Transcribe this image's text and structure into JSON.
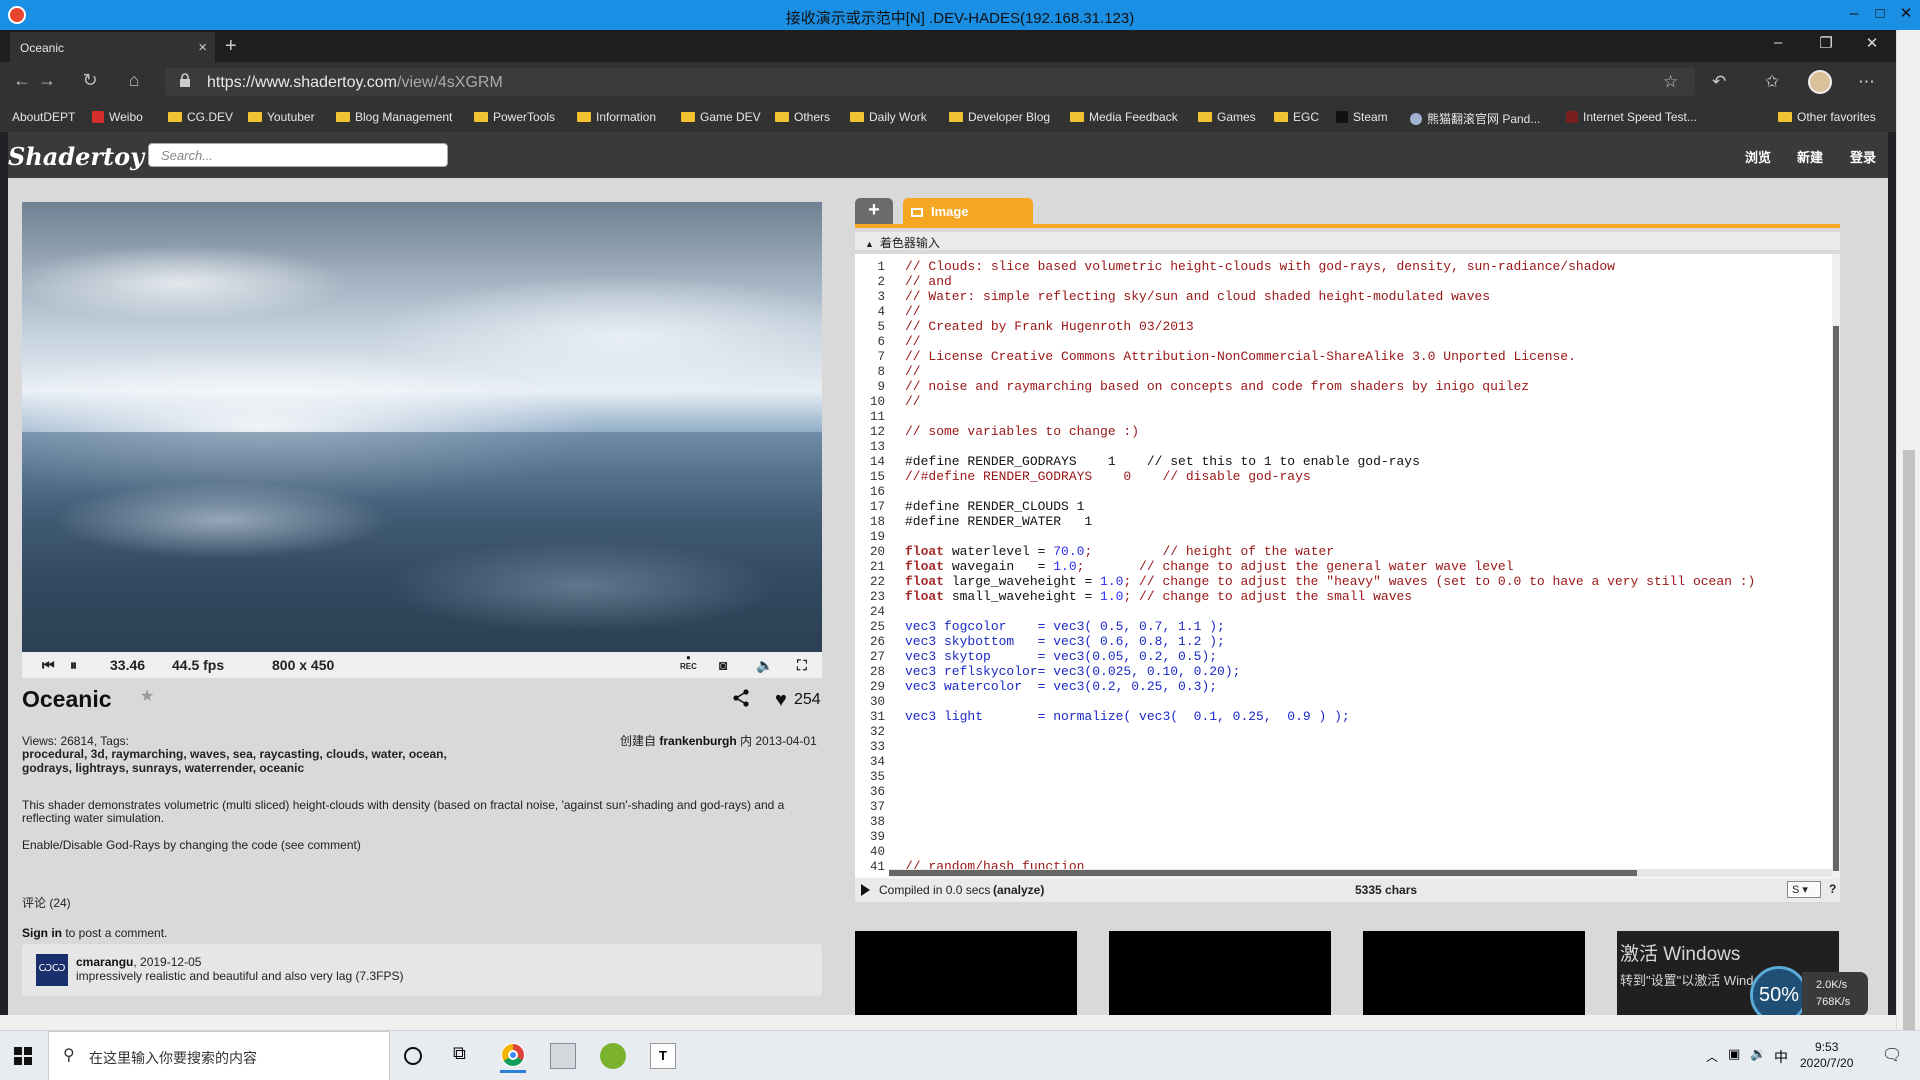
{
  "remote_desktop": {
    "title": "接收演示或示范中[N] .DEV-HADES(192.168.31.123)"
  },
  "browser": {
    "tab_title": "Oceanic",
    "url_main": "https://www.shadertoy.com",
    "url_path": "/view/4sXGRM",
    "bookmarks": [
      "AboutDEPT",
      "Weibo",
      "CG.DEV",
      "Youtuber",
      "Blog Management",
      "PowerTools",
      "Information",
      "Game DEV",
      "Others",
      "Daily Work",
      "Developer Blog",
      "Media Feedback",
      "Games",
      "EGC",
      "Steam",
      "熊猫翻滚官网 Pand...",
      "Internet Speed Test..."
    ],
    "other_favorites": "Other favorites"
  },
  "shadertoy": {
    "logo": "Shadertoy",
    "search_placeholder": "Search...",
    "nav": [
      "浏览",
      "新建",
      "登录"
    ],
    "player": {
      "time": "33.46",
      "fps": "44.5 fps",
      "resolution": "800 x 450",
      "rec_label": "REC"
    },
    "shader": {
      "title": "Oceanic",
      "likes": "254",
      "views_line": "Views: 26814, Tags:",
      "tags_line1": "procedural, 3d, raymarching, waves, sea, raycasting, clouds, water, ocean,",
      "tags_line2": "godrays, lightrays, sunrays, waterrender, oceanic",
      "created_prefix": "创建自",
      "author": "frankenburgh",
      "created_suffix": "内 2013-04-01",
      "description_1": "This shader demonstrates volumetric (multi sliced) height-clouds with density (based on fractal noise, 'against sun'-shading and god-rays) and a",
      "description_2": "reflecting water simulation.",
      "description_3": "Enable/Disable God-Rays by changing the code (see comment)",
      "comments_count": "评论 (24)",
      "signin_link": "Sign in",
      "signin_suffix": "to post a comment.",
      "comment": {
        "user": "cmarangu",
        "date": ", 2019-12-05",
        "text": "impressively realistic and beautiful and also very lag (7.3FPS)"
      }
    },
    "editor": {
      "add_tab": "+",
      "tab_label": "Image",
      "inputs_label": "着色器输入",
      "compiled": "Compiled in 0.0 secs",
      "analyze": "(analyze)",
      "chars": "5335 chars",
      "select_value": "S",
      "help": "?",
      "line_numbers": [
        "1",
        "2",
        "3",
        "4",
        "5",
        "6",
        "7",
        "8",
        "9",
        "10",
        "11",
        "12",
        "13",
        "14",
        "15",
        "16",
        "17",
        "18",
        "19",
        "20",
        "21",
        "22",
        "23",
        "24",
        "25",
        "26",
        "27",
        "28",
        "29",
        "30",
        "31",
        "32",
        "33",
        "34",
        "35",
        "36",
        "37",
        "38",
        "39",
        "40",
        "41"
      ],
      "code": {
        "l1": "// Clouds: slice based volumetric height-clouds with god-rays, density, sun-radiance/shadow",
        "l2": "// and",
        "l3": "// Water: simple reflecting sky/sun and cloud shaded height-modulated waves",
        "l4": "//",
        "l5": "// Created by Frank Hugenroth 03/2013",
        "l6": "//",
        "l7": "// License Creative Commons Attribution-NonCommercial-ShareAlike 3.0 Unported License.",
        "l8": "//",
        "l9": "// noise and raymarching based on concepts and code from shaders by inigo quilez",
        "l10": "//",
        "l12": "// some variables to change :)",
        "l14": "#define RENDER_GODRAYS    1    // set this to 1 to enable god-rays",
        "l15": "//#define RENDER_GODRAYS    0    // disable god-rays",
        "l17": "#define RENDER_CLOUDS 1",
        "l18": "#define RENDER_WATER   1",
        "l20_kw": "float",
        "l20_rest": " waterlevel = ",
        "l20_num": "70.0",
        "l20_cm": ";         // height of the water",
        "l21_kw": "float",
        "l21_rest": " wavegain   = ",
        "l21_num": "1.0",
        "l21_cm": ";       // change to adjust the general water wave level",
        "l22_kw": "float",
        "l22_rest": " large_waveheight = ",
        "l22_num": "1.0",
        "l22_cm": "; // change to adjust the \"heavy\" waves (set to 0.0 to have a very still ocean :)",
        "l23_kw": "float",
        "l23_rest": " small_waveheight = ",
        "l23_num": "1.0",
        "l23_cm": "; // change to adjust the small waves",
        "l25": "vec3 fogcolor    = vec3( 0.5, 0.7, 1.1 );",
        "l26": "vec3 skybottom   = vec3( 0.6, 0.8, 1.2 );",
        "l27": "vec3 skytop      = vec3(0.05, 0.2, 0.5);",
        "l28": "vec3 reflskycolor= vec3(0.025, 0.10, 0.20);",
        "l29": "vec3 watercolor  = vec3(0.2, 0.25, 0.3);",
        "l31": "vec3 light       = normalize( vec3(  0.1, 0.25,  0.9 ) );",
        "l41": "// random/hash function"
      }
    },
    "watermark": {
      "line1": "激活 Windows",
      "line2": "转到\"设置\"以激活 Windows。"
    }
  },
  "net_widget": {
    "percent": "50%",
    "up": "2.0K/s",
    "down": "768K/s"
  },
  "taskbar": {
    "search_placeholder": "在这里输入你要搜索的内容",
    "ime": "中",
    "time": "9:53",
    "date": "2020/7/20"
  },
  "colors": {
    "accent_orange": "#f5a623",
    "rd_titlebar": "#1a8fe3",
    "shadertoy_header": "#3a3a3a"
  }
}
